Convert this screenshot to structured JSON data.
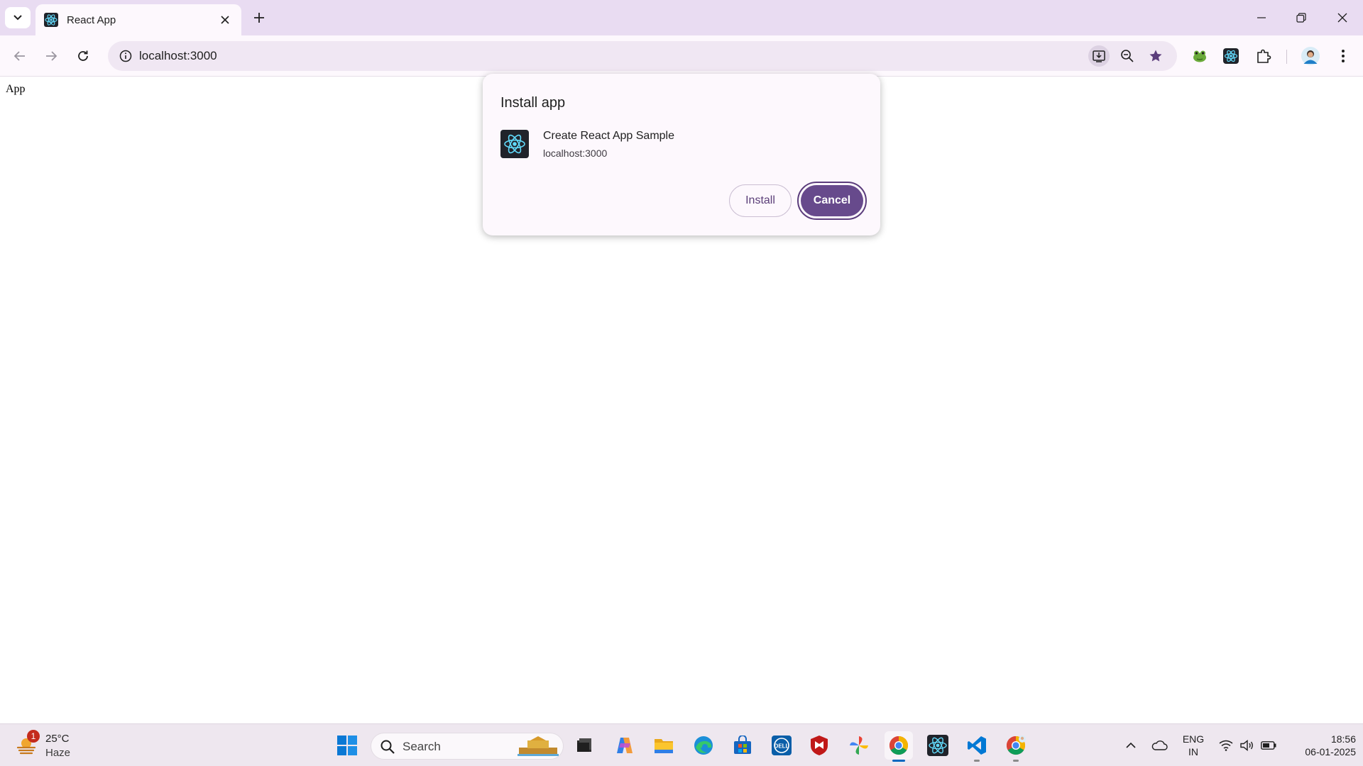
{
  "browser": {
    "tab": {
      "title": "React App"
    },
    "address_bar": {
      "url": "localhost:3000"
    },
    "colors": {
      "frame": "#e9dcf2",
      "toolbar": "#fdf8fd",
      "accent": "#674a8c"
    }
  },
  "page": {
    "body_text": "App"
  },
  "install_dialog": {
    "title": "Install app",
    "app_name": "Create React App Sample",
    "app_origin": "localhost:3000",
    "install_label": "Install",
    "cancel_label": "Cancel"
  },
  "taskbar": {
    "weather": {
      "badge": "1",
      "temperature": "25°C",
      "condition": "Haze"
    },
    "search": {
      "label": "Search"
    },
    "tray": {
      "language": "ENG",
      "region": "IN"
    },
    "clock": {
      "time": "18:56",
      "date": "06-01-2025"
    }
  },
  "icons": [
    "tab-search-icon",
    "react-favicon-icon",
    "close-icon",
    "plus-icon",
    "minimize-icon",
    "restore-icon",
    "back-arrow-icon",
    "forward-arrow-icon",
    "reload-icon",
    "site-info-icon",
    "install-app-icon",
    "zoom-out-icon",
    "bookmark-star-icon",
    "extension-frog-icon",
    "extension-react-icon",
    "extensions-puzzle-icon",
    "profile-avatar-icon",
    "more-vert-icon",
    "windows-start-icon",
    "search-icon",
    "file-explorer-icon",
    "copilot-icon",
    "folder-icon",
    "edge-icon",
    "store-icon",
    "dell-icon",
    "mcafee-icon",
    "pinwheel-icon",
    "chrome-icon",
    "react-devtools-icon",
    "vscode-icon",
    "chevron-up-icon",
    "onedrive-icon",
    "wifi-icon",
    "volume-icon",
    "battery-icon"
  ]
}
